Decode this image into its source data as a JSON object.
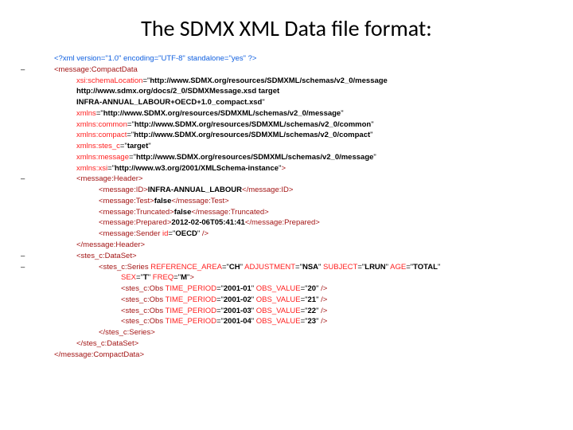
{
  "title": "The SDMX XML Data file format:",
  "tokens": {
    "xml_decl_open": "<?xml ",
    "xml_decl_attrs": "version=\"1.0\" encoding=\"UTF-8\" standalone=\"yes\"",
    "xml_decl_close": " ?>",
    "msg_open": "<message:CompactData",
    "schemaLoc_name": "xsi:schemaLocation",
    "schemaLoc_val1": "http://www.SDMX.org/resources/SDMXML/schemas/v2_0/message",
    "schemaLoc_val2": "http://www.sdmx.org/docs/2_0/SDMXMessage.xsd target",
    "schemaLoc_val3": "INFRA-ANNUAL_LABOUR+OECD+1.0_compact.xsd",
    "xmlns_name": "xmlns",
    "xmlns_val": "http://www.SDMX.org/resources/SDMXML/schemas/v2_0/message",
    "xmlns_common_name": "xmlns:common",
    "xmlns_common_val": "http://www.SDMX.org/resources/SDMXML/schemas/v2_0/common",
    "xmlns_compact_name": "xmlns:compact",
    "xmlns_compact_val": "http://www.SDMX.org/resources/SDMXML/schemas/v2_0/compact",
    "xmlns_stes_name": "xmlns:stes_c",
    "xmlns_stes_val": "target",
    "xmlns_message_name": "xmlns:message",
    "xmlns_message_val": "http://www.SDMX.org/resources/SDMXML/schemas/v2_0/message",
    "xmlns_xsi_name": "xmlns:xsi",
    "xmlns_xsi_val": "http://www.w3.org/2001/XMLSchema-instance",
    "angle_close": ">",
    "header_open": "<message:Header>",
    "id_open": "<message:ID>",
    "id_val": "INFRA-ANNUAL_LABOUR",
    "id_close": "</message:ID>",
    "test_open": "<message:Test>",
    "test_val": "false",
    "test_close": "</message:Test>",
    "trunc_open": "<message:Truncated>",
    "trunc_val": "false",
    "trunc_close": "</message:Truncated>",
    "prep_open": "<message:Prepared>",
    "prep_val": "2012-02-06T05:41:41",
    "prep_close": "</message:Prepared>",
    "sender_open": "<message:Sender ",
    "sender_id_name": "id",
    "sender_id_val": "OECD",
    "self_close": " />",
    "header_close": "</message:Header>",
    "dataset_open": "<stes_c:DataSet>",
    "series_open": "<stes_c:Series ",
    "ref_area_name": "REFERENCE_AREA",
    "ref_area_val": "CH",
    "adj_name": "ADJUSTMENT",
    "adj_val": "NSA",
    "subj_name": "SUBJECT",
    "subj_val": "LRUN",
    "age_name": "AGE",
    "age_val": "TOTAL",
    "sex_name": "SEX",
    "sex_val": "T",
    "freq_name": "FREQ",
    "freq_val": "M",
    "obs_open": "<stes_c:Obs ",
    "time_name": "TIME_PERIOD",
    "obsval_name": "OBS_VALUE",
    "time_v1": "2001-01",
    "obs_v1": "20",
    "time_v2": "2001-02",
    "obs_v2": "21",
    "time_v3": "2001-03",
    "obs_v3": "22",
    "time_v4": "2001-04",
    "obs_v4": "23",
    "series_close": "</stes_c:Series>",
    "dataset_close": "</stes_c:DataSet>",
    "msg_close": "</message:CompactData>",
    "eq": "=",
    "dq": "\"",
    "sp": " ",
    "minus": "–"
  }
}
